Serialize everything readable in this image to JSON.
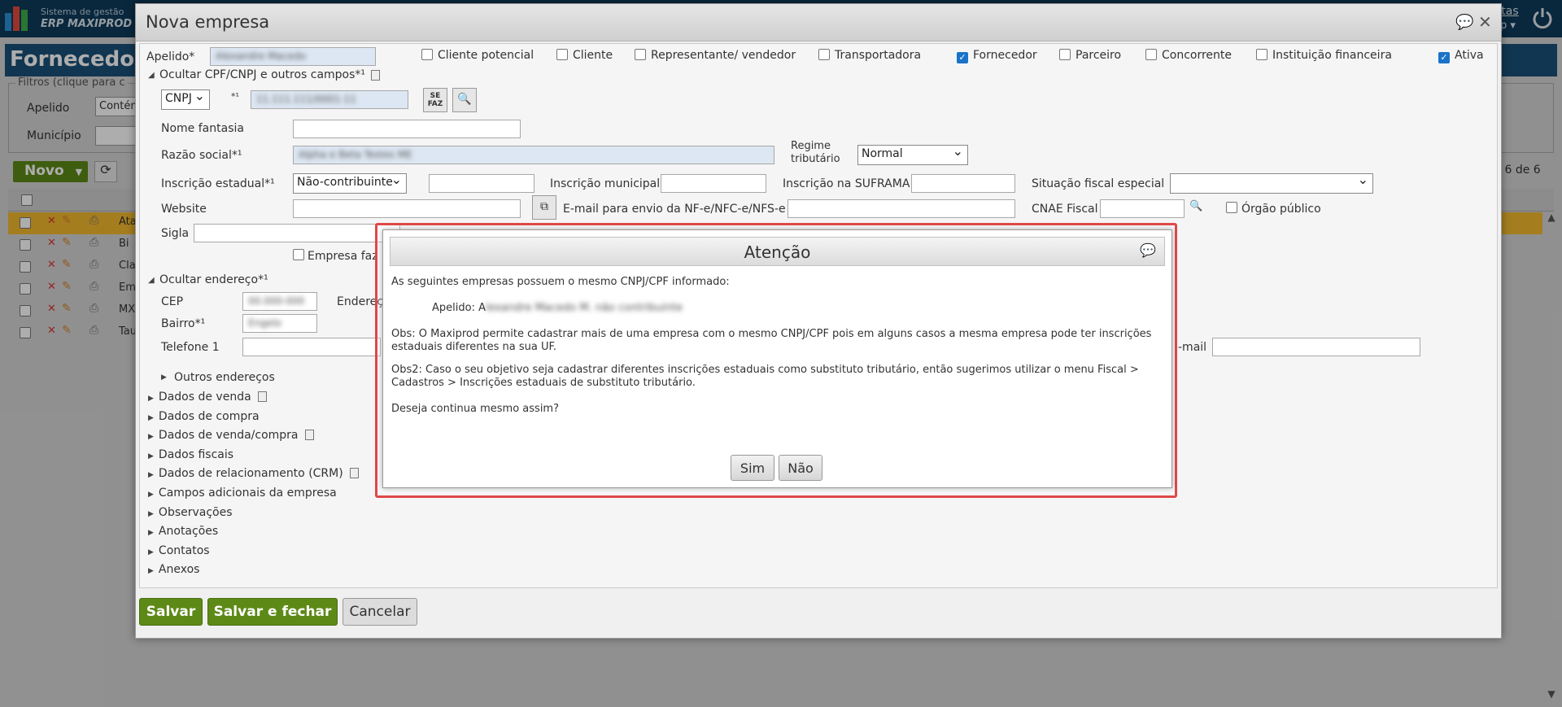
{
  "topbar": {
    "logo_line1": "Sistema de gestão",
    "logo_line2": "ERP MAXIPROD",
    "link_fragment": "stas",
    "menu_fragment": "p ▾"
  },
  "background": {
    "page_title": "Fornecedor",
    "filters_legend": "Filtros (clique para c",
    "apelido_label": "Apelido",
    "apelido_value": "Contém",
    "municipio_label": "Município",
    "novo_button": "Novo",
    "count_text": "- 6 de 6",
    "rows": [
      "Ata",
      "Bi",
      "Cla",
      "Em",
      "MX",
      "Tau"
    ]
  },
  "dialog": {
    "title": "Nova empresa",
    "apelido_label": "Apelido*",
    "apelido_value": "Alexandre Macedo",
    "checkboxes": [
      {
        "label": "Cliente potencial",
        "checked": false
      },
      {
        "label": "Cliente",
        "checked": false
      },
      {
        "label": "Representante/ vendedor",
        "checked": false
      },
      {
        "label": "Transportadora",
        "checked": false
      },
      {
        "label": "Fornecedor",
        "checked": true
      },
      {
        "label": "Parceiro",
        "checked": false
      },
      {
        "label": "Concorrente",
        "checked": false
      },
      {
        "label": "Instituição financeira",
        "checked": false
      },
      {
        "label": "Ativa",
        "checked": true
      }
    ],
    "cpf_section": "Ocultar CPF/CNPJ e outros campos*¹",
    "doc_type": "CNPJ",
    "doc_marker": "*¹",
    "doc_value": "11.111.111/0001-11",
    "nome_fantasia_label": "Nome fantasia",
    "razao_social_label": "Razão social*¹",
    "razao_social_value": "Alpha e Beta Testes ME",
    "regime_label_1": "Regime",
    "regime_label_2": "tributário",
    "regime_value": "Normal",
    "ie_label": "Inscrição estadual*¹",
    "ie_value": "Não-contribuinte",
    "im_label": "Inscrição municipal",
    "suframa_label": "Inscrição na SUFRAMA",
    "sit_fiscal_label": "Situação fiscal especial",
    "website_label": "Website",
    "email_nf_label": "E-mail para envio da NF-e/NFC-e/NFS-e",
    "cnae_label": "CNAE Fiscal",
    "orgao_label": "Órgão público",
    "sigla_label": "Sigla",
    "empresa_faz_label": "Empresa faz",
    "endereco_section": "Ocultar endereço*¹",
    "cep_label": "CEP",
    "cep_value": "00.000-000",
    "endereco_label": "Endereç",
    "bairro_label": "Bairro*¹",
    "bairro_value": "Engelo",
    "telefone_label": "Telefone 1",
    "email_label": "-mail",
    "outros_enderecos": "Outros endereços",
    "sections": [
      "Dados de venda",
      "Dados de compra",
      "Dados de venda/compra",
      "Dados fiscais",
      "Dados de relacionamento (CRM)",
      "Campos adicionais da empresa",
      "Observações",
      "Anotações",
      "Contatos",
      "Anexos"
    ],
    "buttons": {
      "salvar": "Salvar",
      "salvar_fechar": "Salvar e fechar",
      "cancelar": "Cancelar"
    }
  },
  "modal": {
    "title": "Atenção",
    "line1": "As seguintes empresas possuem o mesmo CNPJ/CPF informado:",
    "apelido_prefix": "Apelido: A",
    "apelido_rest": "lexandre Macedo M. não contribuinte",
    "obs1": "Obs: O Maxiprod permite cadastrar mais de uma empresa com o mesmo CNPJ/CPF pois em alguns casos a mesma empresa pode ter inscrições estaduais diferentes na sua UF.",
    "obs2": "Obs2: Caso o seu objetivo seja cadastrar diferentes inscrições estaduais como substituto tributário, então sugerimos utilizar o menu Fiscal > Cadastros > Inscrições estaduais de substituto tributário.",
    "question": "Deseja continua mesmo assim?",
    "yes": "Sim",
    "no": "Não"
  }
}
